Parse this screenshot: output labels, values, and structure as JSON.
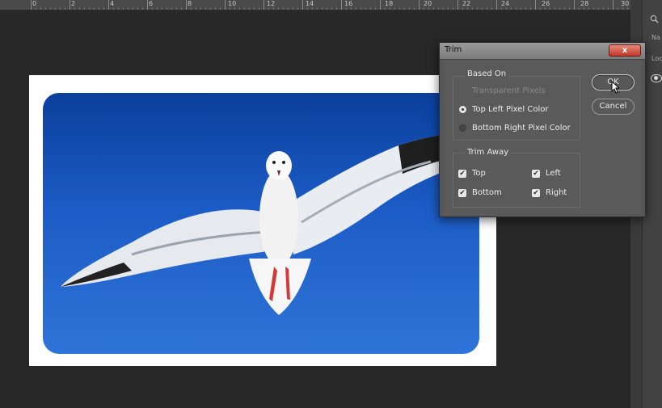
{
  "ruler": {
    "labels": [
      "0",
      "2",
      "4",
      "6",
      "8",
      "10",
      "12",
      "14",
      "16",
      "18",
      "20",
      "22",
      "24",
      "26",
      "28",
      "30"
    ]
  },
  "right_panel": {
    "text_1": "Na",
    "text_2": "Lock"
  },
  "dialog": {
    "title": "Trim",
    "close_label": "x",
    "based_on": {
      "label": "Based On",
      "options": [
        {
          "label": "Transparent Pixels",
          "state": "disabled"
        },
        {
          "label": "Top Left Pixel Color",
          "state": "selected"
        },
        {
          "label": "Bottom Right Pixel Color",
          "state": "unselected"
        }
      ]
    },
    "trim_away": {
      "label": "Trim Away",
      "top": "Top",
      "left": "Left",
      "bottom": "Bottom",
      "right": "Right",
      "checked": [
        true,
        true,
        true,
        true
      ]
    },
    "ok_label": "OK",
    "cancel_label": "Cancel"
  },
  "colors": {
    "workspace": "#282828",
    "dialog_bg": "#5a5a5a",
    "sky": "#1c5cc6"
  }
}
